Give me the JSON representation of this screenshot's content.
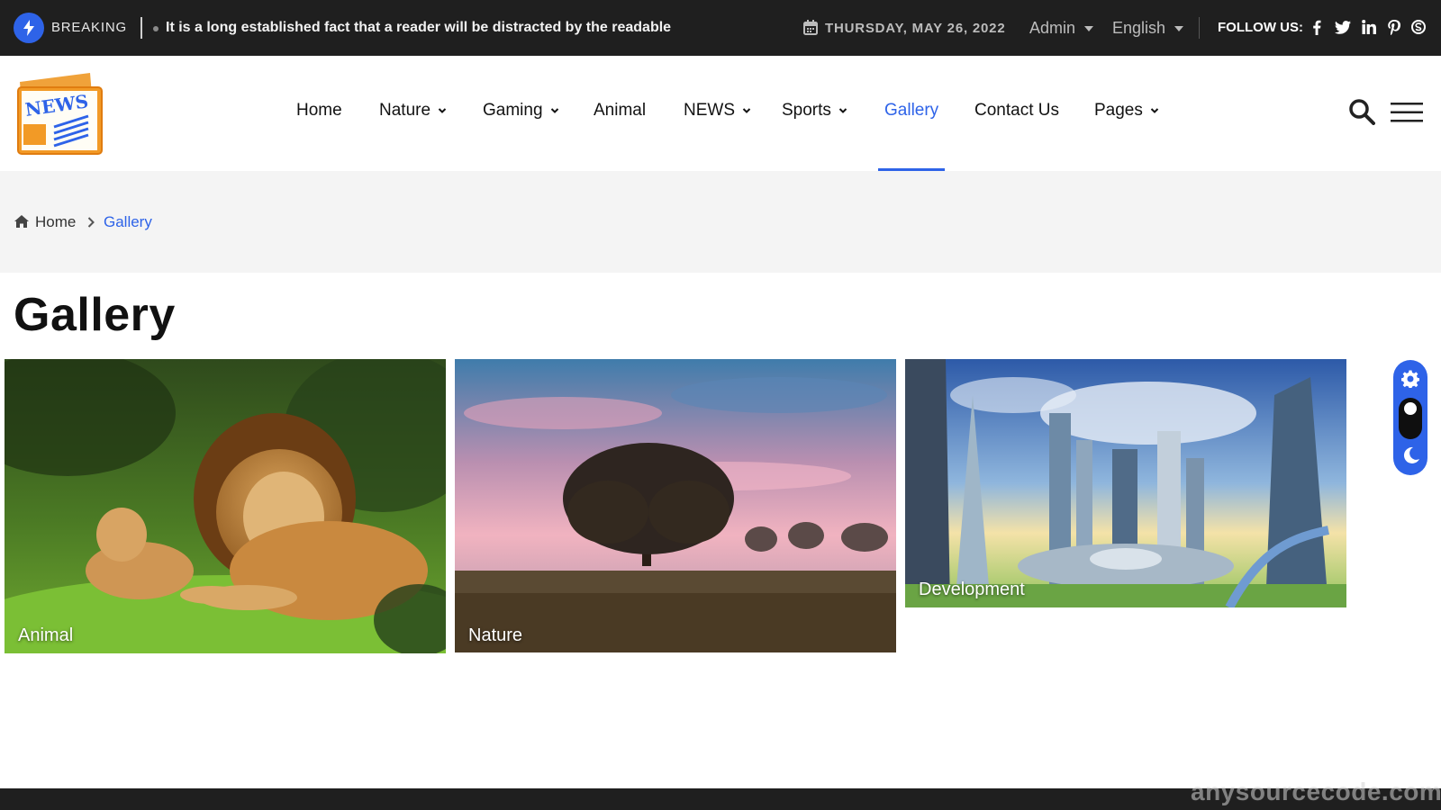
{
  "topbar": {
    "breaking_label": "BREAKING",
    "ticker_text": "It is a long established fact that a reader will be distracted by the readable",
    "date": "THURSDAY, MAY 26, 2022",
    "admin_label": "Admin",
    "language_label": "English",
    "follow_label": "FOLLOW US:",
    "socials": [
      "facebook-icon",
      "twitter-icon",
      "linkedin-icon",
      "pinterest-icon",
      "skype-icon"
    ]
  },
  "header": {
    "logo_text": "NEWS",
    "nav": [
      {
        "label": "Home",
        "has_dropdown": false
      },
      {
        "label": "Nature",
        "has_dropdown": true
      },
      {
        "label": "Gaming",
        "has_dropdown": true
      },
      {
        "label": "Animal",
        "has_dropdown": false
      },
      {
        "label": "NEWS",
        "has_dropdown": true
      },
      {
        "label": "Sports",
        "has_dropdown": true
      },
      {
        "label": "Gallery",
        "has_dropdown": false,
        "active": true
      },
      {
        "label": "Contact Us",
        "has_dropdown": false
      },
      {
        "label": "Pages",
        "has_dropdown": true
      }
    ]
  },
  "breadcrumb": {
    "home": "Home",
    "current": "Gallery"
  },
  "page": {
    "title": "Gallery"
  },
  "gallery": [
    {
      "label": "Animal",
      "image": "lions-on-grass"
    },
    {
      "label": "Nature",
      "image": "tree-at-sunset"
    },
    {
      "label": "Development",
      "image": "futuristic-city"
    }
  ],
  "watermark": "anysourcecode.com",
  "colors": {
    "accent": "#2e63e8",
    "topbar_bg": "#1f1f1f",
    "breadcrumb_bg": "#f4f4f4"
  }
}
